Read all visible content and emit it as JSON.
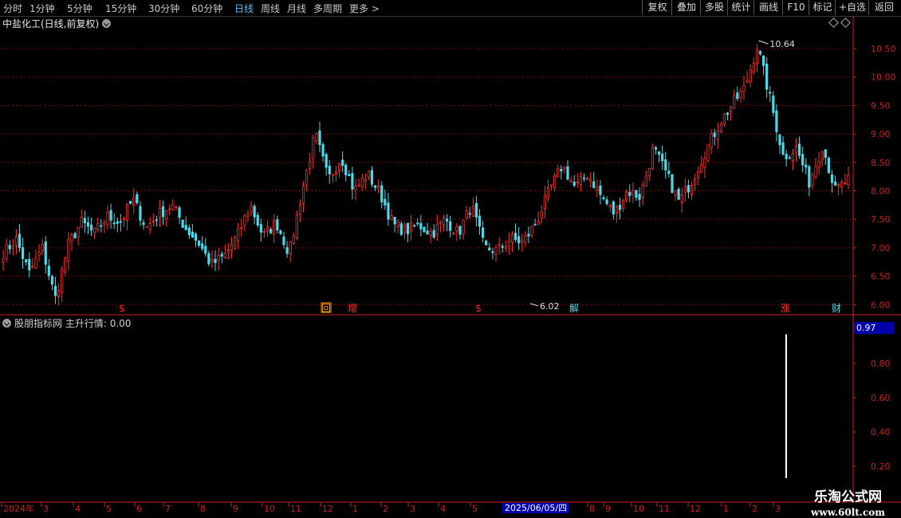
{
  "toolbar": {
    "periods": [
      {
        "label": "分时"
      },
      {
        "label": "1分钟"
      },
      {
        "label": "5分钟"
      },
      {
        "label": "15分钟"
      },
      {
        "label": "30分钟"
      },
      {
        "label": "60分钟"
      },
      {
        "label": "日线"
      },
      {
        "label": "周线"
      },
      {
        "label": "月线"
      },
      {
        "label": "多周期"
      },
      {
        "label": "更多"
      }
    ],
    "active_period": "日线",
    "more_arrow": ">",
    "buttons": [
      {
        "label": "复权"
      },
      {
        "label": "叠加"
      },
      {
        "label": "多股"
      },
      {
        "label": "统计"
      },
      {
        "label": "画线"
      },
      {
        "label": "F10"
      },
      {
        "label": "标记"
      },
      {
        "label": "+自选"
      },
      {
        "label": "返回"
      }
    ]
  },
  "main_title": "中盐化工(日线,前复权)",
  "indicator": {
    "name": "股朋指标网",
    "label": "主升行情:",
    "value": "0.00",
    "badge": "0.97"
  },
  "colors": {
    "up": "#ff3030",
    "down": "#4fd8e8",
    "grid": "#8b0000",
    "axis": "#cc2020",
    "marker_red": "#ff2020"
  },
  "watermark": {
    "text": "乐淘公式网",
    "url": "www.60lt.com"
  },
  "date_cursor": "2025/06/05/四",
  "chart_data": [
    {
      "type": "candlestick",
      "ylim": [
        5.85,
        10.85
      ],
      "yticks": [
        "6.00",
        "6.50",
        "7.00",
        "7.50",
        "8.00",
        "8.50",
        "9.00",
        "9.50",
        "10.00",
        "10.50"
      ],
      "high_label": "10.64",
      "low_label": "6.02",
      "waypoints": [
        6.9,
        7.15,
        6.55,
        7.0,
        6.1,
        7.05,
        7.45,
        7.25,
        7.55,
        7.45,
        7.85,
        7.35,
        7.6,
        7.75,
        7.35,
        7.1,
        6.7,
        6.85,
        7.2,
        7.75,
        7.2,
        7.45,
        6.9,
        8.0,
        9.0,
        8.2,
        8.6,
        8.0,
        8.3,
        7.95,
        7.4,
        7.3,
        7.4,
        7.25,
        7.5,
        7.25,
        7.75,
        7.0,
        6.95,
        7.15,
        7.1,
        7.45,
        8.0,
        8.45,
        8.05,
        8.3,
        7.9,
        7.6,
        8.0,
        7.9,
        8.75,
        8.3,
        7.8,
        8.2,
        8.7,
        9.15,
        9.5,
        9.8,
        10.55,
        9.6,
        8.6,
        8.75,
        8.15,
        8.8,
        8.0,
        8.2
      ],
      "markers": [
        {
          "label": "$",
          "color": "#ff2020"
        },
        {
          "label": "回",
          "color": "#ffa000"
        },
        {
          "label": "增",
          "color": "#ff3030"
        },
        {
          "label": "$",
          "color": "#ff2020"
        },
        {
          "label": "解",
          "color": "#4fd8e8"
        },
        {
          "label": "涨",
          "color": "#ff3030"
        },
        {
          "label": "财",
          "color": "#4fd8e8"
        }
      ]
    },
    {
      "type": "bar",
      "ylim": [
        0,
        1.0
      ],
      "yticks": [
        "0.20",
        "0.40",
        "0.60",
        "0.80"
      ],
      "spike_value": 0.97
    }
  ],
  "xaxis": {
    "labels": [
      "2024年",
      "3",
      "4",
      "5",
      "6",
      "7",
      "8",
      "9",
      "10",
      "11",
      "12",
      "1",
      "2",
      "3",
      "4",
      "5",
      "6",
      "7",
      "8",
      "9",
      "10",
      "11",
      "12",
      "1",
      "2",
      "3"
    ]
  }
}
